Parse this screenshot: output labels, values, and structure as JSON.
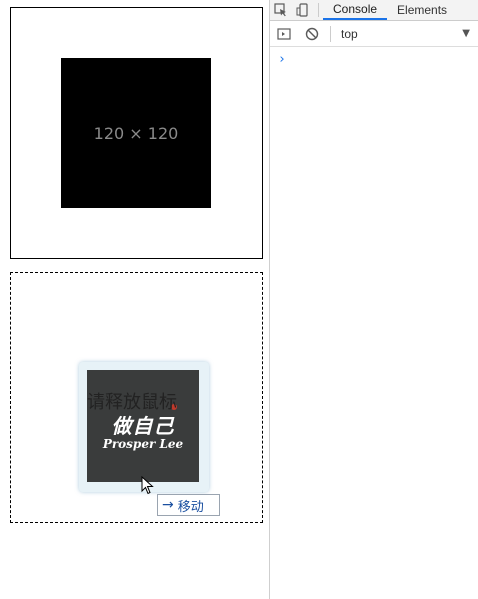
{
  "page": {
    "placeholder_text": "120 × 120",
    "drag_hint": "请释放鼠标",
    "logo_line1": "做自己",
    "logo_line2": "Prosper Lee",
    "move_tip": {
      "arrow": "→",
      "label": "移动"
    }
  },
  "devtools": {
    "tabs": [
      "Console",
      "Elements"
    ],
    "active_tab": "Console",
    "context": "top",
    "prompt_symbol": "›",
    "accent_color": "#1a73e8"
  }
}
